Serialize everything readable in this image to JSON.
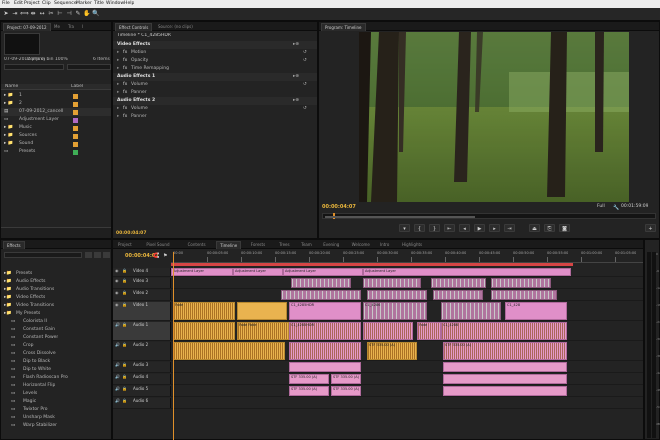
{
  "menu": [
    "File",
    "Edit",
    "Project",
    "Clip",
    "Sequence",
    "Marker",
    "Title",
    "Window",
    "Help"
  ],
  "colors": {
    "accent": "#e8b53c",
    "clip_video": "#e9b34f",
    "clip_pink": "#e08fc8",
    "playhead": "#e0902a",
    "label_orange": "#e3a034",
    "label_green": "#3fae56",
    "label_purple": "#b06ac5"
  },
  "project_panel": {
    "tabs": [
      "Project: 07-09-2012",
      "Me",
      "Tra",
      "I"
    ],
    "info_text": "07-09-2012.prproj",
    "items_text": "Items in bin 100%",
    "items_count": "6 Items",
    "col_name": "Name",
    "col_label": "Label",
    "items": [
      {
        "name": "1",
        "type": "folder",
        "color": "#e3a034"
      },
      {
        "name": "2",
        "type": "folder",
        "color": "#e3a034"
      },
      {
        "name": "07-09-2012_cancell",
        "type": "seq",
        "color": "#e3a034"
      },
      {
        "name": "Adjustment Layer",
        "type": "clip",
        "color": "#b06ac5"
      },
      {
        "name": "Music",
        "type": "folder",
        "color": "#e3a034"
      },
      {
        "name": "Sources",
        "type": "folder",
        "color": "#e3a034"
      },
      {
        "name": "Sound",
        "type": "folder",
        "color": "#e3a034"
      },
      {
        "name": "Presets",
        "type": "file",
        "color": "#3fae56"
      }
    ]
  },
  "effect_controls": {
    "tabs": [
      "Effect Controls",
      "Source: (no clips)"
    ],
    "clip_name": "Timeline * C1_4285HDR",
    "sections": [
      {
        "label": "Video Effects",
        "header": true
      },
      {
        "label": "Motion",
        "header": false
      },
      {
        "label": "Opacity",
        "header": false
      },
      {
        "label": "Time Remapping",
        "header": false
      },
      {
        "label": "Audio Effects 1",
        "header": true
      },
      {
        "label": "Volume",
        "header": false
      },
      {
        "label": "Panner",
        "header": false
      },
      {
        "label": "Audio Effects 2",
        "header": true
      },
      {
        "label": "Volume",
        "header": false
      },
      {
        "label": "Panner",
        "header": false
      }
    ],
    "timecode": "00:00:04:07"
  },
  "program": {
    "tab": "Program: Timeline",
    "timecode": "00:00:04:07",
    "fit": "Full",
    "duration": "00:01:59:09",
    "playhead_fraction": 0.03
  },
  "effects_panel": {
    "tab": "Effects",
    "search_placeholder": "",
    "items": [
      {
        "label": "Presets",
        "indent": 0,
        "type": "folder"
      },
      {
        "label": "Audio Effects",
        "indent": 0,
        "type": "folder"
      },
      {
        "label": "Audio Transitions",
        "indent": 0,
        "type": "folder"
      },
      {
        "label": "Video Effects",
        "indent": 0,
        "type": "folder"
      },
      {
        "label": "Video Transitions",
        "indent": 0,
        "type": "folder"
      },
      {
        "label": "My Presets",
        "indent": 0,
        "type": "folder"
      },
      {
        "label": "Colorista II",
        "indent": 1,
        "type": "fx"
      },
      {
        "label": "Constant Gain",
        "indent": 1,
        "type": "fx"
      },
      {
        "label": "Constant Power",
        "indent": 1,
        "type": "fx"
      },
      {
        "label": "Crop",
        "indent": 1,
        "type": "fx"
      },
      {
        "label": "Cross Dissolve",
        "indent": 1,
        "type": "fx"
      },
      {
        "label": "Dip to Black",
        "indent": 1,
        "type": "fx"
      },
      {
        "label": "Dip to White",
        "indent": 1,
        "type": "fx"
      },
      {
        "label": "Flash Radioscan Pro",
        "indent": 1,
        "type": "fx"
      },
      {
        "label": "Horizontal Flip",
        "indent": 1,
        "type": "fx"
      },
      {
        "label": "Levels",
        "indent": 1,
        "type": "fx"
      },
      {
        "label": "Magic",
        "indent": 1,
        "type": "fx"
      },
      {
        "label": "Twixtor Pro",
        "indent": 1,
        "type": "fx"
      },
      {
        "label": "Unsharp Mask",
        "indent": 1,
        "type": "fx"
      },
      {
        "label": "Warp Stabilizer",
        "indent": 1,
        "type": "fx"
      }
    ]
  },
  "timeline": {
    "tabs": [
      "Project",
      "Pixel Sound",
      "Contents",
      "Timeline",
      "Forests",
      "Trees",
      "Team",
      "Evening",
      "Welcome",
      "Intro",
      "Highlights"
    ],
    "active_tab": 3,
    "timecode": "00:00:04:07",
    "ruler": [
      "00:00",
      "00:00:05:00",
      "00:00:10:00",
      "00:00:15:00",
      "00:00:20:00",
      "00:00:25:00",
      "00:00:30:00",
      "00:00:35:00",
      "00:00:40:00",
      "00:00:45:00",
      "00:00:50:00",
      "00:00:55:00",
      "00:01:00:00",
      "00:01:05:00"
    ],
    "tracks": [
      "Video 4",
      "Video 3",
      "Video 2",
      "Video 1",
      "Audio 1",
      "Audio 2",
      "Audio 3",
      "Audio 4",
      "Audio 5",
      "Audio 6"
    ],
    "adjustment_clips": [
      "Adjustment Layer",
      "Adjustment Layer",
      "Adjustment Layer",
      "Adjustment Layer"
    ],
    "v1_labels": [
      "Fade",
      "C1_4285HDR",
      "C1_4286",
      "C1_428"
    ],
    "a1_labels": [
      "Fade Fade",
      "C1_4285HDR",
      "Fade",
      "C1_4286"
    ],
    "a2_labels": [
      "STF 335.00 (A)",
      "STF 335.00 (A)"
    ],
    "a4_labels": [
      "STF 335.00 (A)",
      "STF 335.00 (A)"
    ],
    "a5_labels": [
      "STF 335.00 (A)",
      "STF 335.00 (A)"
    ]
  },
  "meter_scale": [
    "0",
    "-6",
    "-12",
    "-18",
    "-24",
    "-30",
    "-36",
    "-42",
    "-48",
    "-54",
    "dB"
  ]
}
